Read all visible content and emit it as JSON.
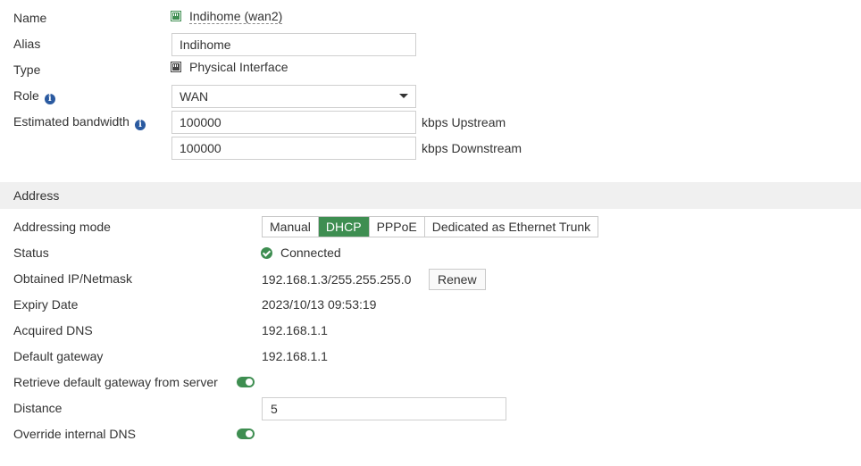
{
  "form": {
    "name_label": "Name",
    "name_value": "Indihome (wan2)",
    "alias_label": "Alias",
    "alias_value": "Indihome",
    "type_label": "Type",
    "type_value": "Physical Interface",
    "role_label": "Role",
    "role_value": "WAN",
    "bandwidth_label": "Estimated bandwidth",
    "upstream_value": "100000",
    "upstream_unit": "kbps Upstream",
    "downstream_value": "100000",
    "downstream_unit": "kbps Downstream"
  },
  "address": {
    "section_title": "Address",
    "mode_label": "Addressing mode",
    "modes": [
      "Manual",
      "DHCP",
      "PPPoE",
      "Dedicated as Ethernet Trunk"
    ],
    "active_mode": "DHCP",
    "status_label": "Status",
    "status_value": "Connected",
    "ip_label": "Obtained IP/Netmask",
    "ip_value": "192.168.1.3/255.255.255.0",
    "renew_label": "Renew",
    "expiry_label": "Expiry Date",
    "expiry_value": "2023/10/13 09:53:19",
    "dns_label": "Acquired DNS",
    "dns_value": "192.168.1.1",
    "gateway_label": "Default gateway",
    "gateway_value": "192.168.1.1",
    "retrieve_label": "Retrieve default gateway from server",
    "retrieve_enabled": true,
    "distance_label": "Distance",
    "distance_value": "5",
    "override_dns_label": "Override internal DNS",
    "override_dns_enabled": true
  },
  "colors": {
    "accent_green": "#3e8e51",
    "info_blue": "#2a5aa0",
    "section_bg": "#f0f0f0"
  },
  "icons": {
    "port": "network-port-icon",
    "info": "info-circle-icon",
    "status": "check-circle-icon",
    "dropdown": "caret-down-icon"
  }
}
